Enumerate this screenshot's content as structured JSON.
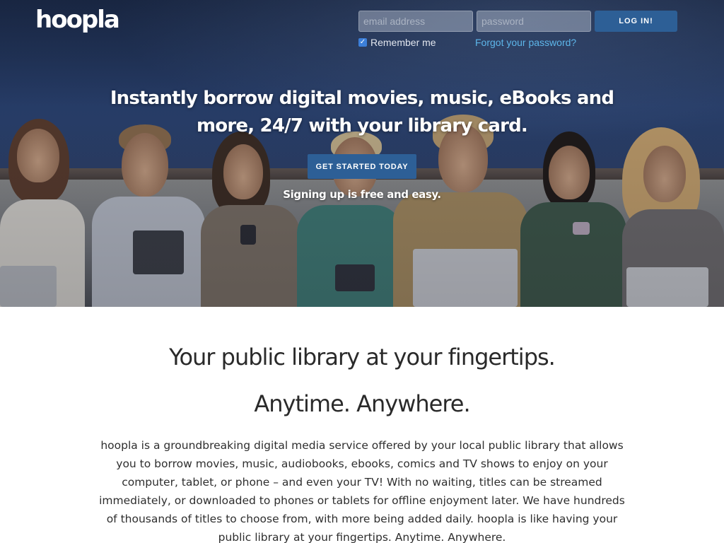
{
  "header": {
    "logo_text": "hoopla",
    "login": {
      "email_placeholder": "email address",
      "password_placeholder": "password",
      "button_label": "LOG IN!",
      "remember_label": "Remember me",
      "remember_checked": true,
      "forgot_label": "Forgot your password?"
    }
  },
  "hero": {
    "headline": "Instantly borrow digital movies, music, eBooks and more, 24/7 with your library card.",
    "cta_label": "GET STARTED TODAY",
    "cta_subtext": "Signing up is free and easy."
  },
  "content": {
    "title_1": "Your public library at your fingertips.",
    "title_2": "Anytime. Anywhere.",
    "description": "hoopla is a groundbreaking digital media service offered by your local public library that allows you to borrow movies, music, audiobooks, ebooks, comics and TV shows to enjoy on your computer, tablet, or phone – and even your TV! With no waiting, titles can be streamed immediately, or downloaded to phones or tablets for offline enjoyment later. We have hundreds of thousands of titles to choose from, with more being added daily. hoopla is like having your public library at your fingertips. Anytime. Anywhere."
  },
  "colors": {
    "primary_button": "#2d5f96",
    "link": "#5db6ea",
    "checkbox": "#3c7fd9"
  }
}
